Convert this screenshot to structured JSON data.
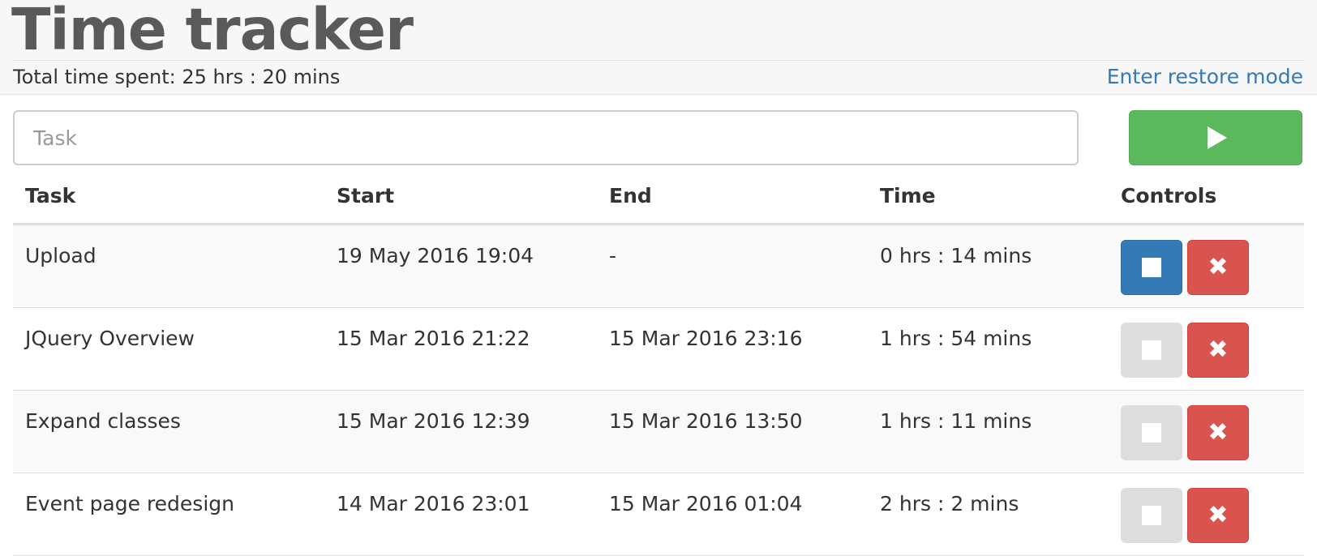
{
  "header": {
    "title": "Time tracker",
    "total_time": "Total time spent: 25 hrs : 20 mins",
    "restore_link": "Enter restore mode"
  },
  "task_input": {
    "value": "",
    "placeholder": "Task"
  },
  "start_button": {
    "icon": "play-icon",
    "color": "#5cb85c"
  },
  "table": {
    "columns": [
      "Task",
      "Start",
      "End",
      "Time",
      "Controls"
    ],
    "rows": [
      {
        "task": "Upload",
        "start": "19 May 2016 19:04",
        "end": "-",
        "time": "0 hrs : 14 mins",
        "running": true
      },
      {
        "task": "JQuery Overview",
        "start": "15 Mar 2016 21:22",
        "end": "15 Mar 2016 23:16",
        "time": "1 hrs : 54 mins",
        "running": false
      },
      {
        "task": "Expand classes",
        "start": "15 Mar 2016 12:39",
        "end": "15 Mar 2016 13:50",
        "time": "1 hrs : 11 mins",
        "running": false
      },
      {
        "task": "Event page redesign",
        "start": "14 Mar 2016 23:01",
        "end": "15 Mar 2016 01:04",
        "time": "2 hrs : 2 mins",
        "running": false
      }
    ]
  },
  "controls": {
    "stop_icon": "stop-icon",
    "delete_icon": "close-icon",
    "delete_glyph": "✖",
    "stop_active_color": "#337ab7",
    "stop_inactive_color": "#dddddd",
    "delete_color": "#d9534f"
  }
}
